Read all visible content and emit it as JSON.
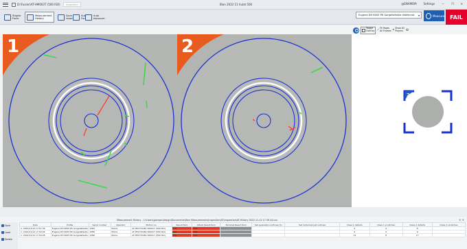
{
  "window": {
    "file_name": "D:\\Fusion\\AT-HM003T (500 ISO)",
    "badge": "Inspection",
    "center_title": "Bion 2022 11 hulat 500",
    "user": "@ENAMOM",
    "settings": "Settings",
    "minimize_glyph": "—",
    "maximize_glyph": "❐",
    "close_glyph": "✕"
  },
  "toolbar": {
    "buttons": [
      {
        "label": "Stapler\nFacts"
      },
      {
        "label": "Measurement\nHistory"
      },
      {
        "label": "Save\nreport"
      },
      {
        "label": "Auto\nFocus"
      },
      {
        "label": "Auto\nexposure"
      }
    ],
    "product_select": "Eugene DH 6005 PK Gorgellefestie dilefecrad",
    "measure_label": "Measure",
    "verdict": "FAIL"
  },
  "view_controls": {
    "toggle_overlay": "Toggle\nOverlay",
    "fit_all": "Fit Pages\nAll Frames",
    "show_all": "Show All\nPlayers"
  },
  "panels": [
    {
      "number": "1"
    },
    {
      "number": "2"
    }
  ],
  "thumbnail": {
    "number": "2"
  },
  "results": {
    "title": "Measurement History - C:\\Users\\glensan\\design\\Documents\\Bion Measurements\\Inspection\\AT\\Inspection\\AT-History 2022-11-12 17 59 44.csv",
    "close_glyph": "✕ ✕",
    "sidebar": [
      "Save",
      "Load",
      "Delete"
    ],
    "columns": [
      "Date",
      "Profile",
      "Serial number",
      "Operator",
      "Motion no.",
      "Result Rom",
      "Attack Result Rom",
      "Nominal Result Rom",
      "Set evaluation outlines (S)",
      "Set individual pat outlines",
      "Class 1 defects",
      "Class 1 scratches",
      "Class 2 defects",
      "Class 2 scratches"
    ],
    "rows": [
      [
        "2. 2022/11/12 17:57:36",
        "Eugene DH 6005 PK Gorgellefestie dilefecrad",
        "1081",
        "Pierre",
        "AT-HM-YT0461-YR0017 (500 ISO)",
        "FAIL",
        "FAIL",
        "",
        "",
        "",
        "2",
        "4",
        "6",
        ""
      ],
      [
        "1. 2022/11/12 17:50:44",
        "Eugene DH 6005 PK Gorgellefestie dilefecrad",
        "1080",
        "Pierre",
        "AT-HM-YT0461-YR0017 (500 ISO)",
        "FAIL",
        "FAIL",
        "",
        "",
        "",
        "6",
        "4",
        "9",
        ""
      ],
      [
        "1. 2022/11/12 17:50:28",
        "Eugene DH 6005 PK Gorgellefestie dilefecrad",
        "1080",
        "Pierre",
        "AT-HM-YT0461-YR0017 (500 ISO)",
        "FAIL",
        "FAIL",
        "",
        "",
        "",
        "12",
        "6",
        "17",
        ""
      ]
    ]
  },
  "colors": {
    "accent": "#1d5fb3",
    "fail": "#e4002b",
    "corner": "#e95a1f",
    "ring": "#1a2fd1",
    "defect_green": "#39d94a",
    "defect_red": "#ff3a2e"
  }
}
